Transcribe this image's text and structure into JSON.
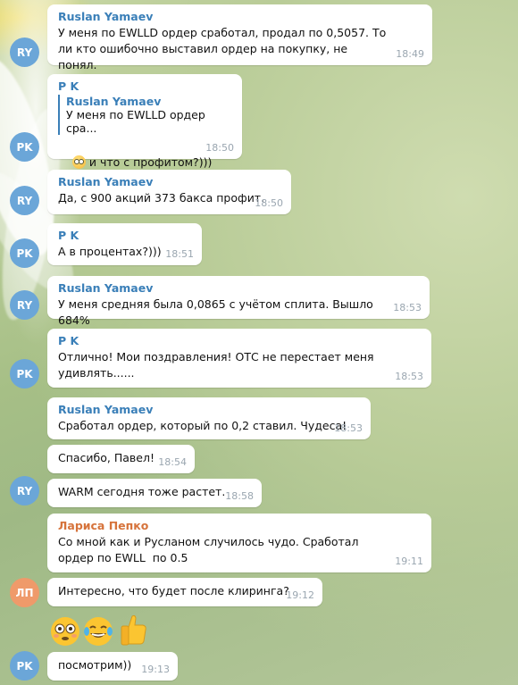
{
  "messages": [
    {
      "avatar": "RY",
      "sender": "Ruslan Yamaev",
      "text": "У меня по EWLLD ордер сработал, продал по 0,5057. То ли кто ошибочно выставил ордер на покупку, не понял.",
      "time": "18:49"
    },
    {
      "avatar": "PK",
      "sender": "P K",
      "reply": {
        "name": "Ruslan Yamaev",
        "text": "У меня по EWLLD ордер сра..."
      },
      "text": "и что с профитом?)))",
      "time": "18:50",
      "emoji": "flushed-face"
    },
    {
      "avatar": "RY",
      "sender": "Ruslan Yamaev",
      "text": "Да, с 900 акций 373 бакса профит.",
      "time": "18:50"
    },
    {
      "avatar": "PK",
      "sender": "P K",
      "text": "А в процентах?)))",
      "time": "18:51"
    },
    {
      "avatar": "RY",
      "sender": "Ruslan Yamaev",
      "text": "У меня средняя была 0,0865 с учётом сплита. Вышло 684%",
      "time": "18:53"
    },
    {
      "avatar": "PK",
      "sender": "P K",
      "text": "Отлично! Мои поздравления! ОТС не перестает меня удивлять......",
      "time": "18:53"
    },
    {
      "sender": "Ruslan Yamaev",
      "text": "Сработал ордер, который по 0,2 ставил. Чудеса!",
      "time": "18:53"
    },
    {
      "text": "Спасибо, Павел!",
      "time": "18:54"
    },
    {
      "avatar": "RY",
      "text": "WARM сегодня тоже растет.",
      "time": "18:58"
    },
    {
      "sender": "Лариса Пепко",
      "text": "Со мной как и Русланом случилось чудо. Сработал ордер по EWLL  по 0.5",
      "time": "19:11"
    },
    {
      "avatar": "ЛП",
      "text": "Интересно, что будет после клиринга?",
      "time": "19:12"
    },
    {
      "emojis": [
        "flushed-face",
        "tears-of-joy-face",
        "thumbs-up"
      ]
    },
    {
      "avatar": "PK",
      "text": "посмотрим))",
      "time": "19:13"
    }
  ],
  "colors": {
    "accent": "#3a7fb8",
    "orange_name": "#d6733b",
    "avatar_blue": "#6ba6d8",
    "avatar_orange": "#ef9a6a"
  }
}
